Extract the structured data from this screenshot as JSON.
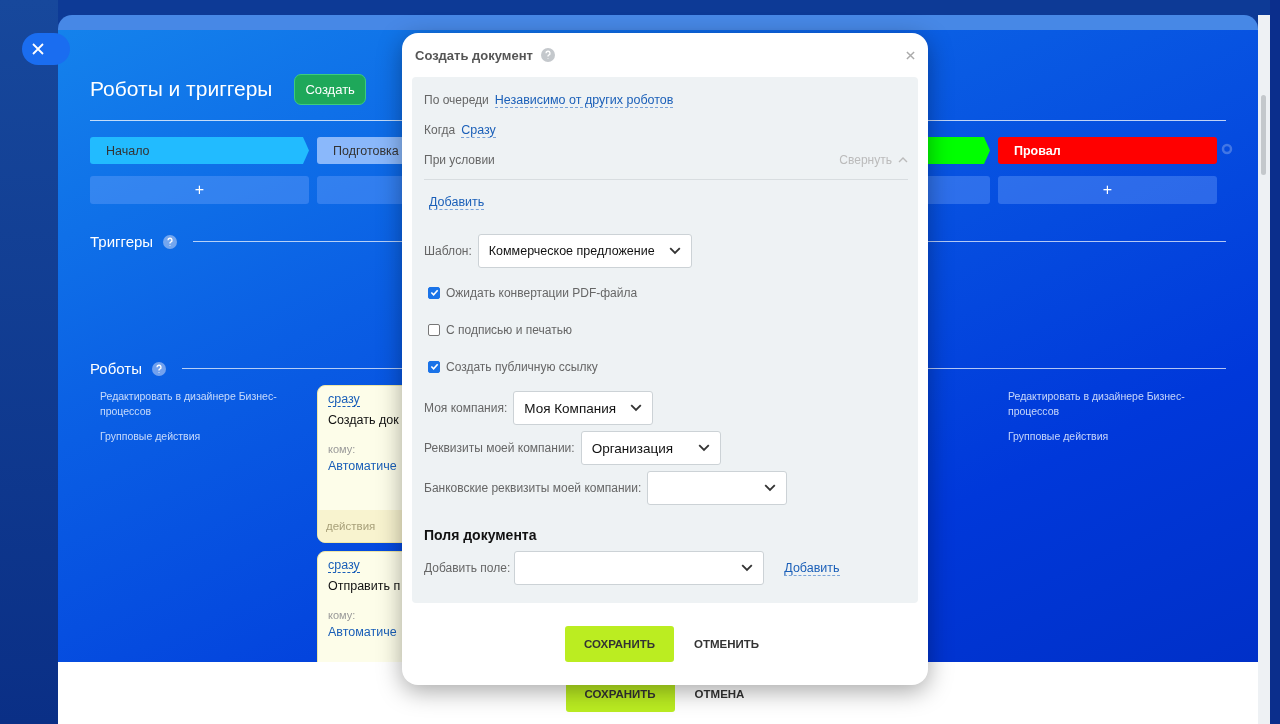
{
  "page": {
    "title": "Роботы и триггеры",
    "create_button": "Создать",
    "columns": [
      {
        "stage": {
          "label": "Начало",
          "color": "#22bbff"
        },
        "add_label": "+",
        "links": [
          "Редактировать в дизайнере Бизнес-процессов",
          "Групповые действия"
        ]
      },
      {
        "stage": {
          "label": "Подготовка",
          "color": "#8ab8fb"
        },
        "cards": [
          {
            "when": "сразу",
            "title": "Создать док",
            "to_label": "кому:",
            "to": "Автоматиче",
            "footer": "действия"
          },
          {
            "when": "сразу",
            "title": "Отправить п",
            "to_label": "кому:",
            "to": "Автоматиче"
          }
        ]
      },
      {
        "stage": {
          "color": "#00ff00"
        }
      },
      {
        "stage": {
          "label": "Провал",
          "color": "#ff0000"
        },
        "add_label": "+",
        "links": [
          "Редактировать в дизайнере Бизнес-процессов",
          "Групповые действия"
        ]
      }
    ],
    "triggers_heading": "Триггеры",
    "robots_heading": "Роботы",
    "footer": {
      "save": "СОХРАНИТЬ",
      "cancel": "ОТМЕНА"
    }
  },
  "dialog": {
    "title": "Создать документ",
    "queue": {
      "label": "По очереди",
      "value": "Независимо от других роботов"
    },
    "when": {
      "label": "Когда",
      "value": "Сразу"
    },
    "condition": {
      "label": "При условии",
      "collapse": "Свернуть",
      "add": "Добавить"
    },
    "template": {
      "label": "Шаблон:",
      "value": "Коммерческое предложение"
    },
    "options": [
      {
        "label": "Ожидать конвертации PDF-файла",
        "checked": true
      },
      {
        "label": "С подписью и печатью",
        "checked": false
      },
      {
        "label": "Создать публичную ссылку",
        "checked": true
      }
    ],
    "selects": [
      {
        "label": "Моя компания:",
        "value": "Моя Компания"
      },
      {
        "label": "Реквизиты моей компании:",
        "value": "Организация"
      },
      {
        "label": "Банковские реквизиты моей компании:"
      }
    ],
    "fields_heading": "Поля документа",
    "add_field": {
      "label": "Добавить поле:",
      "link": "Добавить"
    },
    "buttons": {
      "save": "СОХРАНИТЬ",
      "cancel": "ОТМЕНИТЬ"
    }
  }
}
